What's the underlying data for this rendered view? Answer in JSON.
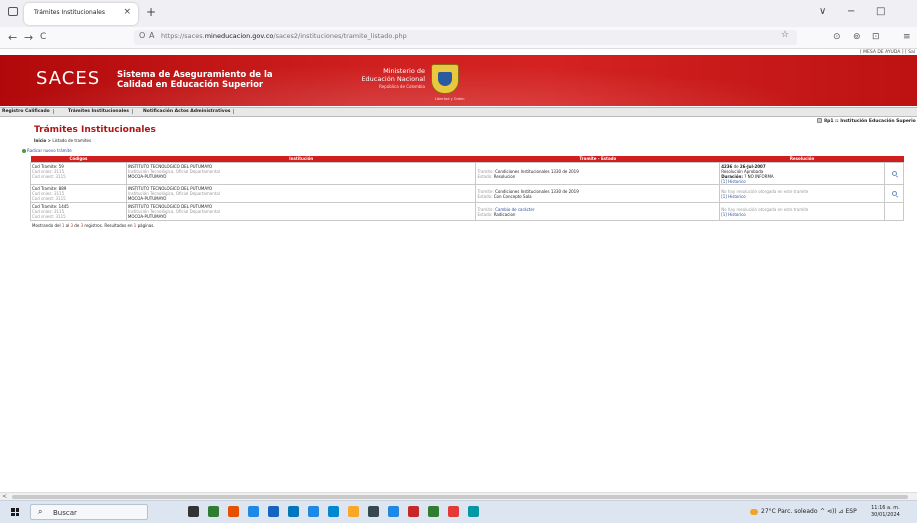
{
  "browser": {
    "tab_title": "Trámites Institucionales",
    "close_glyph": "×",
    "new_tab_glyph": "+",
    "url_prefix": "https://saces.",
    "url_domain": "mineducacion.gov.co",
    "url_path": "/saces2/instituciones/tramite_listado.php",
    "tab_icon": "page-icon",
    "back_glyph": "←",
    "forward_glyph": "→",
    "reload_glyph": "C",
    "lock_glyph": "A",
    "shield_glyph": "O",
    "star_glyph": "☆",
    "win_minimize": "−",
    "win_maximize": "□",
    "win_collapse": "∨",
    "ext1_glyph": "⊙",
    "ext2_glyph": "⊚",
    "ext3_glyph": "⊡",
    "menu_glyph": "≡"
  },
  "page": {
    "top_links": "[ MESA DE AYUDA ]   [ Sal",
    "header": {
      "brand": "SACES",
      "system_line1": "Sistema de Aseguramiento de la",
      "system_line2": "Calidad en Educación Superior",
      "ministry_line1": "Ministerio de",
      "ministry_line2": "Educación Nacional",
      "ministry_line3": "República de Colombia",
      "motto": "Libertad y Orden"
    },
    "menu": [
      "Registro Calificado",
      "Trámites Institucionales",
      "Notificación Actos Administrativos"
    ],
    "user_line": "8p1 :: Institución Educación Superio",
    "title": "Trámites Institucionales",
    "breadcrumb_home": "Inicio",
    "breadcrumb_sep": " > ",
    "breadcrumb_current": "Listado de tramites",
    "new_link": "Radicar nuevo trámite",
    "table": {
      "headers": [
        "Códigos",
        "Institución",
        "Tramite - Estado",
        "Resolución"
      ],
      "rows": [
        {
          "cod_tramite": "Cod Tramite: 59",
          "cod_snies": "Cod snies: 3115",
          "cod_sniest": "Cod sniest: 3115",
          "inst_name": "INSTITUTO TECNOLOGICO DEL PUTUMAYO",
          "inst_type": "Institución Tecnológica, Oficial Departamental",
          "inst_city": "MOCOA-PUTUMAYO",
          "tramite_label": "Tramite: ",
          "tramite_value": "Condiciones Institucionales 1330 de 2019",
          "estado_label": "Estado: ",
          "estado_value": "Resolucion",
          "res_number": "4236",
          "res_de": " de ",
          "res_date": "26-Jul-2007",
          "res_status": "Resolución Aprobada",
          "res_dur_label": "Duración:",
          "res_dur_value": " ? NO INFORMA",
          "historico": "[1] Historico"
        },
        {
          "cod_tramite": "Cod Tramite: 889",
          "cod_snies": "Cod snies: 3115",
          "cod_sniest": "Cod sniest: 3115",
          "inst_name": "INSTITUTO TECNOLOGICO DEL PUTUMAYO",
          "inst_type": "Institución Tecnológica, Oficial Departamental",
          "inst_city": "MOCOA-PUTUMAYO",
          "tramite_label": "Tramite: ",
          "tramite_value": "Condiciones Institucionales 1330 de 2019",
          "estado_label": "Estado: ",
          "estado_value": "Con Concepto Sala",
          "res_note": "No hay resolución otorgada en este tramite",
          "historico": "[1] Historico"
        },
        {
          "cod_tramite": "Cod Tramite: 1445",
          "cod_snies": "Cod snies: 3115",
          "cod_sniest": "Cod sniest: 3115",
          "inst_name": "INSTITUTO TECNOLOGICO DEL PUTUMAYO",
          "inst_type": "Institución Tecnológica, Oficial Departamental",
          "inst_city": "MOCOA-PUTUMAYO",
          "tramite_label": "Tramite: ",
          "tramite_value": "Cambio de carácter",
          "estado_label": "Estado: ",
          "estado_value": "Radicacion",
          "res_note": "No hay resolución otorgada en este tramite",
          "historico": "[1] Historico"
        }
      ]
    },
    "footer": {
      "t1": "Mostrando del ",
      "from": "1",
      "t2": " al ",
      "to": "3",
      "t3": " de ",
      "total": "3",
      "t4": " registros. Resultados en ",
      "pages": "1",
      "t5": " páginas."
    }
  },
  "scrollbar": {
    "left_arrow": "<"
  },
  "taskbar": {
    "search_icon_glyph": "⌕",
    "search_placeholder": "Buscar",
    "weather": "27°C  Parc. soleado",
    "tray": "^  ⊲))  ⊿  ESP",
    "time": "11:16 a. m.",
    "date": "30/01/2024",
    "app_colors": [
      "#333333",
      "#2e7d32",
      "#e65100",
      "#1e88e5",
      "#1565c0",
      "#0277bd",
      "#1e88e5",
      "#0288d1",
      "#f9a825",
      "#37474f",
      "#1e88e5",
      "#c62828",
      "#2e7d32",
      "#e53935",
      "#0097a7"
    ]
  }
}
